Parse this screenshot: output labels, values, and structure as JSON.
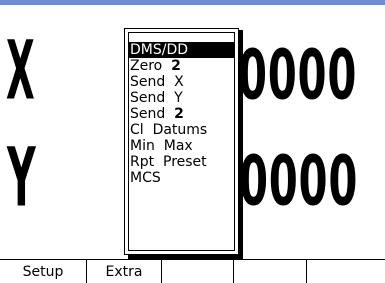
{
  "display": {
    "axis_x_label": "X",
    "axis_y_label": "Y",
    "x_value_visible": "0000",
    "y_value_visible": "0000"
  },
  "menu": {
    "items": [
      {
        "label": "DMS/DD",
        "value": "",
        "selected": true
      },
      {
        "label": "Zero  ",
        "value": "2",
        "selected": false
      },
      {
        "label": "Send  X",
        "value": "",
        "selected": false
      },
      {
        "label": "Send  Y",
        "value": "",
        "selected": false
      },
      {
        "label": "Send  ",
        "value": "2",
        "selected": false
      },
      {
        "label": "Cl  Datums",
        "value": "",
        "selected": false
      },
      {
        "label": "Min  Max",
        "value": "",
        "selected": false
      },
      {
        "label": "Rpt  Preset",
        "value": "",
        "selected": false
      },
      {
        "label": "MCS",
        "value": "",
        "selected": false
      }
    ]
  },
  "softkeys": [
    {
      "label": "Setup"
    },
    {
      "label": "Extra"
    },
    {
      "label": ""
    },
    {
      "label": ""
    },
    {
      "label": ""
    }
  ],
  "colors": {
    "top_border": "#6f8ccc",
    "selected_bg": "#000000",
    "selected_fg": "#ffffff"
  }
}
